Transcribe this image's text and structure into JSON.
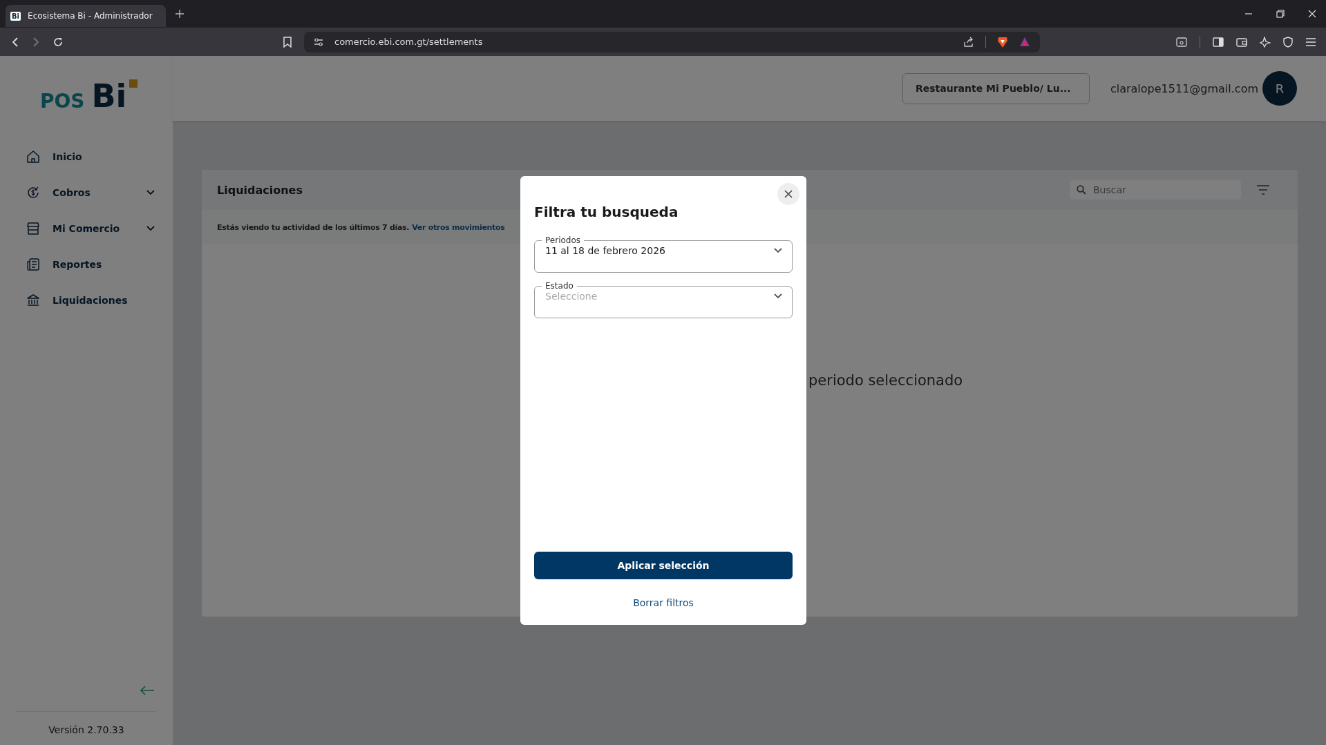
{
  "browser": {
    "tab": {
      "favicon_text": "Bi",
      "title": "Ecosistema Bi - Administrador"
    },
    "url": "comercio.ebi.com.gt/settlements"
  },
  "sidebar": {
    "logo": {
      "prefix": "POS",
      "name": "Bi"
    },
    "items": [
      {
        "label": "Inicio",
        "expandable": false
      },
      {
        "label": "Cobros",
        "expandable": true
      },
      {
        "label": "Mi Comercio",
        "expandable": true
      },
      {
        "label": "Reportes",
        "expandable": false
      },
      {
        "label": "Liquidaciones",
        "expandable": false
      }
    ],
    "version": "Versión 2.70.33"
  },
  "header": {
    "store_selector": "Restaurante Mi Pueblo/ Lu...",
    "email": "claralope1511@gmail.com",
    "avatar": "R"
  },
  "content": {
    "title": "Liquidaciones",
    "search": {
      "placeholder": "Buscar"
    },
    "notice": "Estás viendo tu actividad de los últimos 7 días.",
    "notice_link": "Ver otros movimientos",
    "empty_message": "periodo seleccionado"
  },
  "modal": {
    "title": "Filtra tu busqueda",
    "fields": [
      {
        "label": "Periodos",
        "value": "11 al 18 de febrero 2026"
      },
      {
        "label": "Estado",
        "placeholder": "Seleccione"
      }
    ],
    "primary_button": "Aplicar selección",
    "secondary_button": "Borrar filtros"
  }
}
